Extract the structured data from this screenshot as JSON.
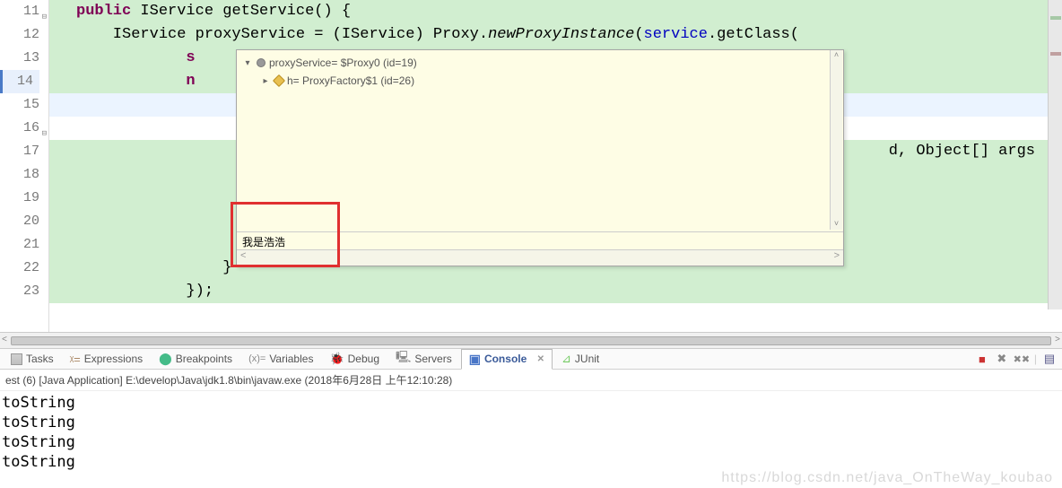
{
  "gutter": {
    "lines": [
      "11",
      "12",
      "13",
      "14",
      "15",
      "16",
      "17",
      "18",
      "19",
      "20",
      "21",
      "22",
      "23"
    ]
  },
  "code": {
    "l11_kw": "public",
    "l11_type": " IService ",
    "l11_method": "getService",
    "l11_rest": "() {",
    "l12_a": "    IService proxyService = (IService) Proxy.",
    "l12_b": "newProxyInstance",
    "l12_c": "(",
    "l12_d": "service",
    "l12_e": ".getClass(",
    "l13": "            s",
    "l14": "            n",
    "l17_tail": "d, Object[] args",
    "l22": "                }",
    "l23": "            });"
  },
  "hover": {
    "row1": "proxyService= $Proxy0  (id=19)",
    "row2": "h= ProxyFactory$1  (id=26)",
    "detail": "我是浩浩",
    "nav_prev": "<",
    "nav_next": ">"
  },
  "tabs": {
    "tasks": "Tasks",
    "expressions": "Expressions",
    "breakpoints": "Breakpoints",
    "variables": "Variables",
    "debug": "Debug",
    "servers": "Servers",
    "console": "Console",
    "junit": "JUnit",
    "close_glyph": "✕"
  },
  "console": {
    "header": "est (6) [Java Application] E:\\develop\\Java\\jdk1.8\\bin\\javaw.exe (2018年6月28日 上午12:10:28)",
    "lines": [
      "toString",
      "toString",
      "toString",
      "toString"
    ]
  },
  "watermark": "https://blog.csdn.net/java_OnTheWay_koubao"
}
